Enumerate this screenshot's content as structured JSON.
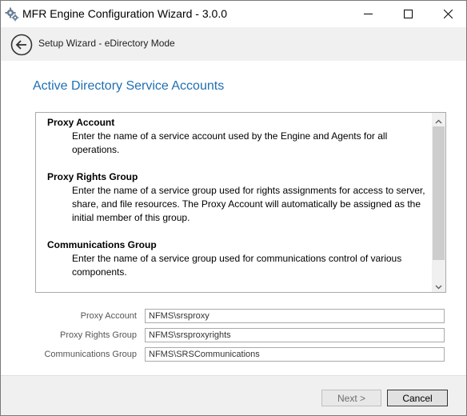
{
  "window": {
    "title": "MFR Engine Configuration Wizard - 3.0.0",
    "app_icon": "gear-icon"
  },
  "nav": {
    "title": "Setup Wizard - eDirectory Mode",
    "back_icon": "back-arrow-icon"
  },
  "page": {
    "heading": "Active Directory Service Accounts"
  },
  "info": {
    "sections": [
      {
        "heading": "Proxy Account",
        "description": "Enter the name of a service account used by the Engine and Agents for all operations."
      },
      {
        "heading": "Proxy Rights Group",
        "description": "Enter the name of a service group used for rights assignments for access to server, share, and file resources.  The Proxy Account will automatically be assigned as the initial member of this group."
      },
      {
        "heading": "Communications Group",
        "description": "Enter the name of a service group used for communications control of various components."
      }
    ]
  },
  "fields": [
    {
      "label": "Proxy Account",
      "value": "NFMS\\srsproxy"
    },
    {
      "label": "Proxy Rights Group",
      "value": "NFMS\\srsproxyrights"
    },
    {
      "label": "Communications Group",
      "value": "NFMS\\SRSCommunications"
    }
  ],
  "buttons": {
    "next": "Next >",
    "cancel": "Cancel"
  },
  "colors": {
    "heading": "#1f6fb2",
    "footer_bg": "#f0f0f0",
    "nav_bg": "#f0f0f0"
  }
}
